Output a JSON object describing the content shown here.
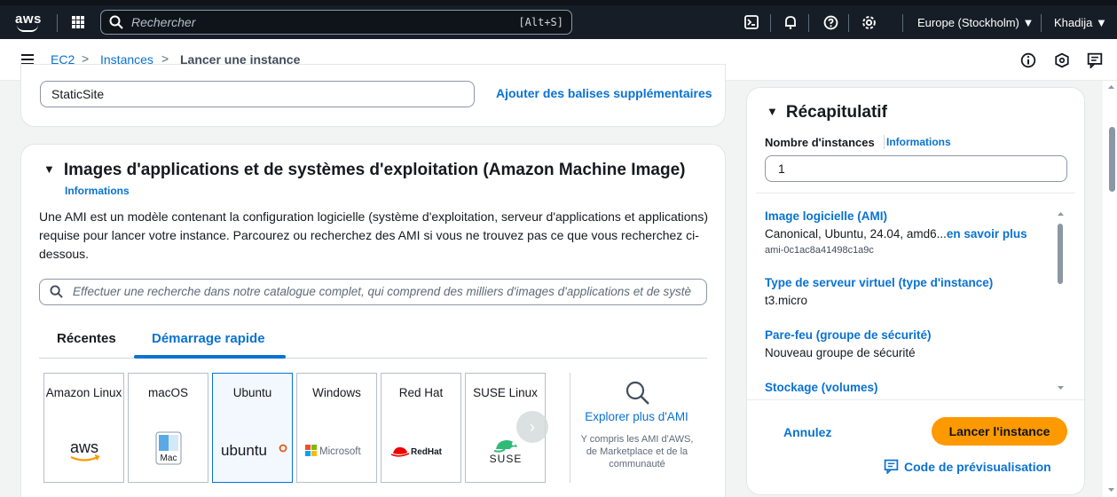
{
  "nav": {
    "logo_text": "aws",
    "search_placeholder": "Rechercher",
    "search_shortcut": "[Alt+S]",
    "region": "Europe (Stockholm) ▼",
    "user": "Khadija ▼"
  },
  "breadcrumb": {
    "items": [
      "EC2",
      "Instances"
    ],
    "current": "Lancer une instance"
  },
  "tags": {
    "value": "StaticSite",
    "more_link": "Ajouter des balises supplémentaires"
  },
  "ami": {
    "title": "Images d'applications et de systèmes d'exploitation (Amazon Machine Image)",
    "info": "Informations",
    "description": "Une AMI est un modèle contenant la configuration logicielle (système d'exploitation, serveur d'applications et applications) requise pour lancer votre instance. Parcourez ou recherchez des AMI si vous ne trouvez pas ce que vous recherchez ci-dessous.",
    "search_placeholder": "Effectuer une recherche dans notre catalogue complet, qui comprend des milliers d'images d'applications et de systè",
    "tabs": [
      "Récentes",
      "Démarrage rapide"
    ],
    "active_tab": "Démarrage rapide",
    "os_options": [
      {
        "name": "Amazon Linux",
        "logo": "aws"
      },
      {
        "name": "macOS",
        "logo": "Mac"
      },
      {
        "name": "Ubuntu",
        "logo": "ubuntu"
      },
      {
        "name": "Windows",
        "logo": "Microsoft"
      },
      {
        "name": "Red Hat",
        "logo": "Red Hat"
      },
      {
        "name": "SUSE Linux",
        "logo": "SUSE"
      }
    ],
    "selected_os": "Ubuntu",
    "explore_label": "Explorer plus d'AMI",
    "explore_sub": "Y compris les AMI d'AWS, de Marketplace et de la communauté"
  },
  "summary": {
    "title": "Récapitulatif",
    "count_label": "Nombre d'instances",
    "count_info": "Informations",
    "count_value": "1",
    "items": [
      {
        "key": "Image logicielle (AMI)",
        "value": "Canonical, Ubuntu, 24.04, amd6...",
        "more": "en savoir plus",
        "small": "ami-0c1ac8a41498c1a9c"
      },
      {
        "key": "Type de serveur virtuel (type d'instance)",
        "value": "t3.micro"
      },
      {
        "key": "Pare-feu (groupe de sécurité)",
        "value": "Nouveau groupe de sécurité"
      },
      {
        "key": "Stockage (volumes)"
      }
    ],
    "cancel": "Annulez",
    "launch": "Lancer l'instance",
    "preview": "Code de prévisualisation"
  },
  "colors": {
    "link": "#0972d3",
    "launch_button": "#ff9900",
    "nav_bg": "#161d26"
  }
}
